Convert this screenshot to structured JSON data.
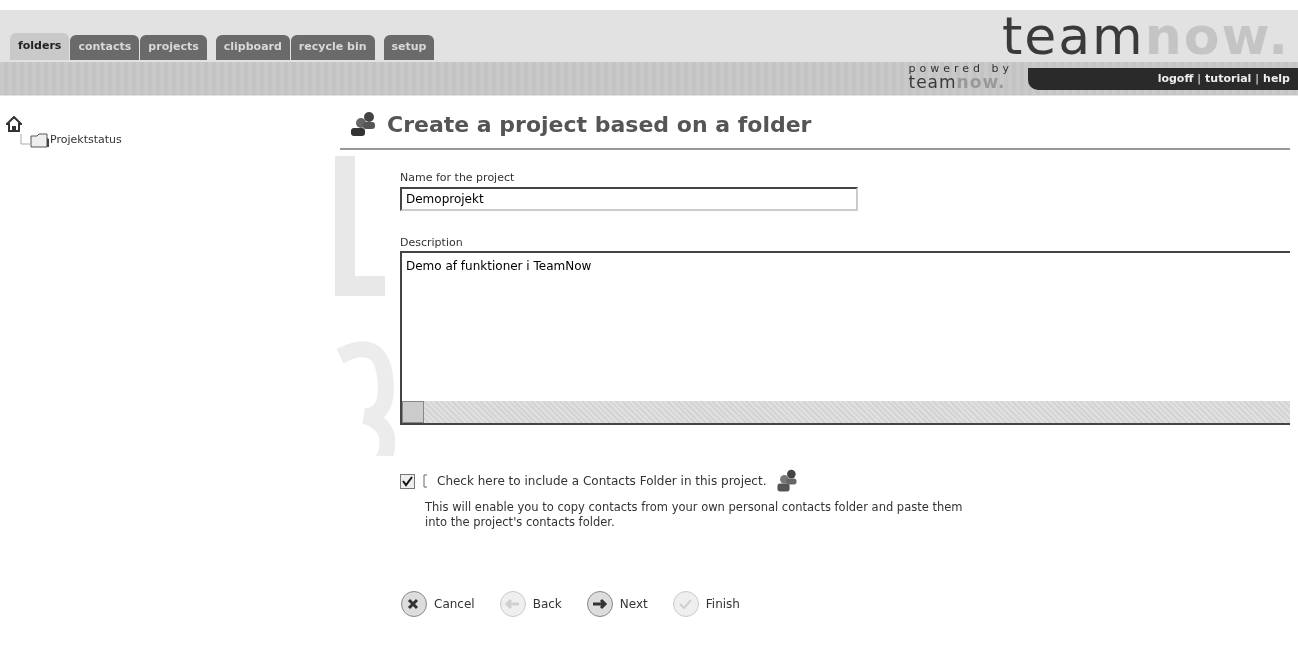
{
  "tab_groups": [
    [
      {
        "label": "folders",
        "selected": true
      },
      {
        "label": "contacts",
        "selected": false
      },
      {
        "label": "projects",
        "selected": false
      }
    ],
    [
      {
        "label": "clipboard",
        "selected": false
      },
      {
        "label": "recycle bin",
        "selected": false
      }
    ],
    [
      {
        "label": "setup",
        "selected": false
      }
    ]
  ],
  "logo": {
    "team": "team",
    "now": "now.",
    "powered_by": "powered by",
    "small_team": "team",
    "small_now": "now."
  },
  "user_links": [
    "logoff",
    "tutorial",
    "help"
  ],
  "link_separator": "|",
  "tree": {
    "children": [
      {
        "label": "Projektstatus"
      }
    ]
  },
  "title": "Create a project based on a folder",
  "name_field": {
    "label": "Name for the project",
    "value": "Demoprojekt"
  },
  "description_field": {
    "label": "Description",
    "value": "Demo af funktioner i TeamNow"
  },
  "contacts_option": {
    "checked": true,
    "label": "Check here to include a Contacts Folder in this project.",
    "note": "This will enable you to copy contacts from your own personal contacts folder and paste them into the project's contacts folder."
  },
  "buttons": [
    {
      "label": "Cancel",
      "kind": "cancel",
      "disabled": false
    },
    {
      "label": "Back",
      "kind": "back",
      "disabled": true
    },
    {
      "label": "Next",
      "kind": "next",
      "disabled": false
    },
    {
      "label": "Finish",
      "kind": "finish",
      "disabled": true
    }
  ]
}
